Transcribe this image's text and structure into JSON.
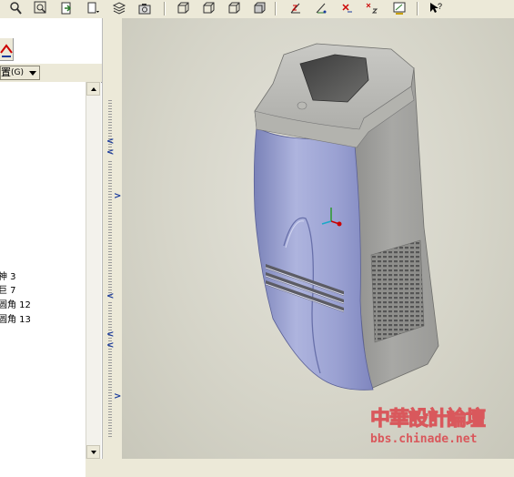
{
  "toolbar": {
    "buttons": [
      "zoom-icon",
      "zoom-window-icon",
      "import-icon",
      "view-list-icon",
      "layers-icon",
      "camera-icon",
      "box-view-icon",
      "box-view-2-icon",
      "box-view-3-icon",
      "shaded-box-icon",
      "axis-z-icon",
      "axis-tri-icon",
      "axis-x-icon",
      "axis-xz-icon",
      "axis-display-icon",
      "whats-this-icon"
    ]
  },
  "left_panel": {
    "combo_label": "置",
    "combo_shortcut": "(G)",
    "tree_items": [
      "神 3",
      "巨 7",
      "圆角 12",
      "圆角 13"
    ]
  },
  "watermark": {
    "title": "中華設計論壇",
    "url": "bbs.chinade.net"
  },
  "colors": {
    "viewport_bg": "#d6d5c9",
    "model_body": "#8f97c9",
    "model_side": "#9a9a98",
    "watermark_red": "#d9585c"
  }
}
